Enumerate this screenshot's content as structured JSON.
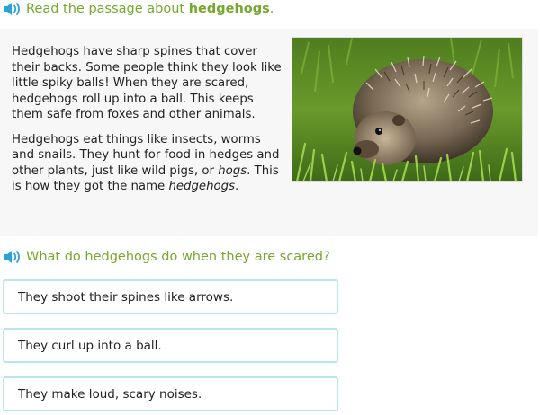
{
  "instruction": {
    "prefix": "Read the passage about ",
    "emphasis": "hedgehogs",
    "suffix": ".",
    "speaker_icon": "speaker-icon"
  },
  "passage": {
    "paragraph1": "Hedgehogs have sharp spines that cover their backs. Some people think they look like little spiky balls! When they are scared, hedgehogs roll up into a ball. This keeps them safe from foxes and other animals.",
    "paragraph2_part1": "Hedgehogs eat things like insects, worms and snails. They hunt for food in hedges and other plants, just like wild pigs, or ",
    "paragraph2_em1": "hogs",
    "paragraph2_part2": ". This is how they got the name ",
    "paragraph2_em2": "hedgehogs",
    "paragraph2_part3": "."
  },
  "question": {
    "text": "What do hedgehogs do when they are scared?",
    "speaker_icon": "speaker-icon"
  },
  "choices": [
    {
      "label": "They shoot their spines like arrows."
    },
    {
      "label": "They curl up into a ball."
    },
    {
      "label": "They make loud, scary noises."
    }
  ],
  "colors": {
    "accent_green": "#74a92c",
    "speaker_blue": "#2aa4d8",
    "choice_border": "#b6e6ef",
    "passage_bg": "#f7f7f7"
  }
}
